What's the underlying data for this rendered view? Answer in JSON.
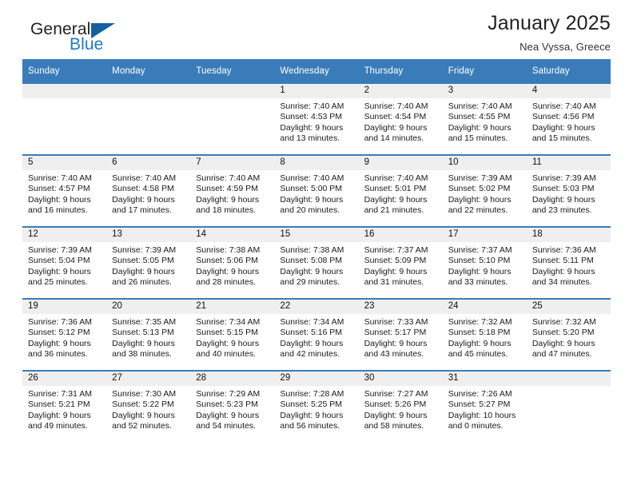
{
  "brand": {
    "name_part1": "General",
    "name_part2": "Blue",
    "mark": "triangle-logo",
    "color_dark": "#231f20",
    "color_blue": "#1e7ac4",
    "mark_color": "#15619f"
  },
  "header": {
    "title": "January 2025",
    "subtitle": "Nea Vyssa, Greece"
  },
  "theme": {
    "header_row_bg": "#3a7cb9",
    "daynum_band_bg": "#efefef",
    "row_divider": "#3a7cb9"
  },
  "weekdays": [
    "Sunday",
    "Monday",
    "Tuesday",
    "Wednesday",
    "Thursday",
    "Friday",
    "Saturday"
  ],
  "weeks": [
    [
      {
        "day": "",
        "sunrise": "",
        "sunset": "",
        "daylight1": "",
        "daylight2": ""
      },
      {
        "day": "",
        "sunrise": "",
        "sunset": "",
        "daylight1": "",
        "daylight2": ""
      },
      {
        "day": "",
        "sunrise": "",
        "sunset": "",
        "daylight1": "",
        "daylight2": ""
      },
      {
        "day": "1",
        "sunrise": "Sunrise: 7:40 AM",
        "sunset": "Sunset: 4:53 PM",
        "daylight1": "Daylight: 9 hours",
        "daylight2": "and 13 minutes."
      },
      {
        "day": "2",
        "sunrise": "Sunrise: 7:40 AM",
        "sunset": "Sunset: 4:54 PM",
        "daylight1": "Daylight: 9 hours",
        "daylight2": "and 14 minutes."
      },
      {
        "day": "3",
        "sunrise": "Sunrise: 7:40 AM",
        "sunset": "Sunset: 4:55 PM",
        "daylight1": "Daylight: 9 hours",
        "daylight2": "and 15 minutes."
      },
      {
        "day": "4",
        "sunrise": "Sunrise: 7:40 AM",
        "sunset": "Sunset: 4:56 PM",
        "daylight1": "Daylight: 9 hours",
        "daylight2": "and 15 minutes."
      }
    ],
    [
      {
        "day": "5",
        "sunrise": "Sunrise: 7:40 AM",
        "sunset": "Sunset: 4:57 PM",
        "daylight1": "Daylight: 9 hours",
        "daylight2": "and 16 minutes."
      },
      {
        "day": "6",
        "sunrise": "Sunrise: 7:40 AM",
        "sunset": "Sunset: 4:58 PM",
        "daylight1": "Daylight: 9 hours",
        "daylight2": "and 17 minutes."
      },
      {
        "day": "7",
        "sunrise": "Sunrise: 7:40 AM",
        "sunset": "Sunset: 4:59 PM",
        "daylight1": "Daylight: 9 hours",
        "daylight2": "and 18 minutes."
      },
      {
        "day": "8",
        "sunrise": "Sunrise: 7:40 AM",
        "sunset": "Sunset: 5:00 PM",
        "daylight1": "Daylight: 9 hours",
        "daylight2": "and 20 minutes."
      },
      {
        "day": "9",
        "sunrise": "Sunrise: 7:40 AM",
        "sunset": "Sunset: 5:01 PM",
        "daylight1": "Daylight: 9 hours",
        "daylight2": "and 21 minutes."
      },
      {
        "day": "10",
        "sunrise": "Sunrise: 7:39 AM",
        "sunset": "Sunset: 5:02 PM",
        "daylight1": "Daylight: 9 hours",
        "daylight2": "and 22 minutes."
      },
      {
        "day": "11",
        "sunrise": "Sunrise: 7:39 AM",
        "sunset": "Sunset: 5:03 PM",
        "daylight1": "Daylight: 9 hours",
        "daylight2": "and 23 minutes."
      }
    ],
    [
      {
        "day": "12",
        "sunrise": "Sunrise: 7:39 AM",
        "sunset": "Sunset: 5:04 PM",
        "daylight1": "Daylight: 9 hours",
        "daylight2": "and 25 minutes."
      },
      {
        "day": "13",
        "sunrise": "Sunrise: 7:39 AM",
        "sunset": "Sunset: 5:05 PM",
        "daylight1": "Daylight: 9 hours",
        "daylight2": "and 26 minutes."
      },
      {
        "day": "14",
        "sunrise": "Sunrise: 7:38 AM",
        "sunset": "Sunset: 5:06 PM",
        "daylight1": "Daylight: 9 hours",
        "daylight2": "and 28 minutes."
      },
      {
        "day": "15",
        "sunrise": "Sunrise: 7:38 AM",
        "sunset": "Sunset: 5:08 PM",
        "daylight1": "Daylight: 9 hours",
        "daylight2": "and 29 minutes."
      },
      {
        "day": "16",
        "sunrise": "Sunrise: 7:37 AM",
        "sunset": "Sunset: 5:09 PM",
        "daylight1": "Daylight: 9 hours",
        "daylight2": "and 31 minutes."
      },
      {
        "day": "17",
        "sunrise": "Sunrise: 7:37 AM",
        "sunset": "Sunset: 5:10 PM",
        "daylight1": "Daylight: 9 hours",
        "daylight2": "and 33 minutes."
      },
      {
        "day": "18",
        "sunrise": "Sunrise: 7:36 AM",
        "sunset": "Sunset: 5:11 PM",
        "daylight1": "Daylight: 9 hours",
        "daylight2": "and 34 minutes."
      }
    ],
    [
      {
        "day": "19",
        "sunrise": "Sunrise: 7:36 AM",
        "sunset": "Sunset: 5:12 PM",
        "daylight1": "Daylight: 9 hours",
        "daylight2": "and 36 minutes."
      },
      {
        "day": "20",
        "sunrise": "Sunrise: 7:35 AM",
        "sunset": "Sunset: 5:13 PM",
        "daylight1": "Daylight: 9 hours",
        "daylight2": "and 38 minutes."
      },
      {
        "day": "21",
        "sunrise": "Sunrise: 7:34 AM",
        "sunset": "Sunset: 5:15 PM",
        "daylight1": "Daylight: 9 hours",
        "daylight2": "and 40 minutes."
      },
      {
        "day": "22",
        "sunrise": "Sunrise: 7:34 AM",
        "sunset": "Sunset: 5:16 PM",
        "daylight1": "Daylight: 9 hours",
        "daylight2": "and 42 minutes."
      },
      {
        "day": "23",
        "sunrise": "Sunrise: 7:33 AM",
        "sunset": "Sunset: 5:17 PM",
        "daylight1": "Daylight: 9 hours",
        "daylight2": "and 43 minutes."
      },
      {
        "day": "24",
        "sunrise": "Sunrise: 7:32 AM",
        "sunset": "Sunset: 5:18 PM",
        "daylight1": "Daylight: 9 hours",
        "daylight2": "and 45 minutes."
      },
      {
        "day": "25",
        "sunrise": "Sunrise: 7:32 AM",
        "sunset": "Sunset: 5:20 PM",
        "daylight1": "Daylight: 9 hours",
        "daylight2": "and 47 minutes."
      }
    ],
    [
      {
        "day": "26",
        "sunrise": "Sunrise: 7:31 AM",
        "sunset": "Sunset: 5:21 PM",
        "daylight1": "Daylight: 9 hours",
        "daylight2": "and 49 minutes."
      },
      {
        "day": "27",
        "sunrise": "Sunrise: 7:30 AM",
        "sunset": "Sunset: 5:22 PM",
        "daylight1": "Daylight: 9 hours",
        "daylight2": "and 52 minutes."
      },
      {
        "day": "28",
        "sunrise": "Sunrise: 7:29 AM",
        "sunset": "Sunset: 5:23 PM",
        "daylight1": "Daylight: 9 hours",
        "daylight2": "and 54 minutes."
      },
      {
        "day": "29",
        "sunrise": "Sunrise: 7:28 AM",
        "sunset": "Sunset: 5:25 PM",
        "daylight1": "Daylight: 9 hours",
        "daylight2": "and 56 minutes."
      },
      {
        "day": "30",
        "sunrise": "Sunrise: 7:27 AM",
        "sunset": "Sunset: 5:26 PM",
        "daylight1": "Daylight: 9 hours",
        "daylight2": "and 58 minutes."
      },
      {
        "day": "31",
        "sunrise": "Sunrise: 7:26 AM",
        "sunset": "Sunset: 5:27 PM",
        "daylight1": "Daylight: 10 hours",
        "daylight2": "and 0 minutes."
      },
      {
        "day": "",
        "sunrise": "",
        "sunset": "",
        "daylight1": "",
        "daylight2": ""
      }
    ]
  ]
}
